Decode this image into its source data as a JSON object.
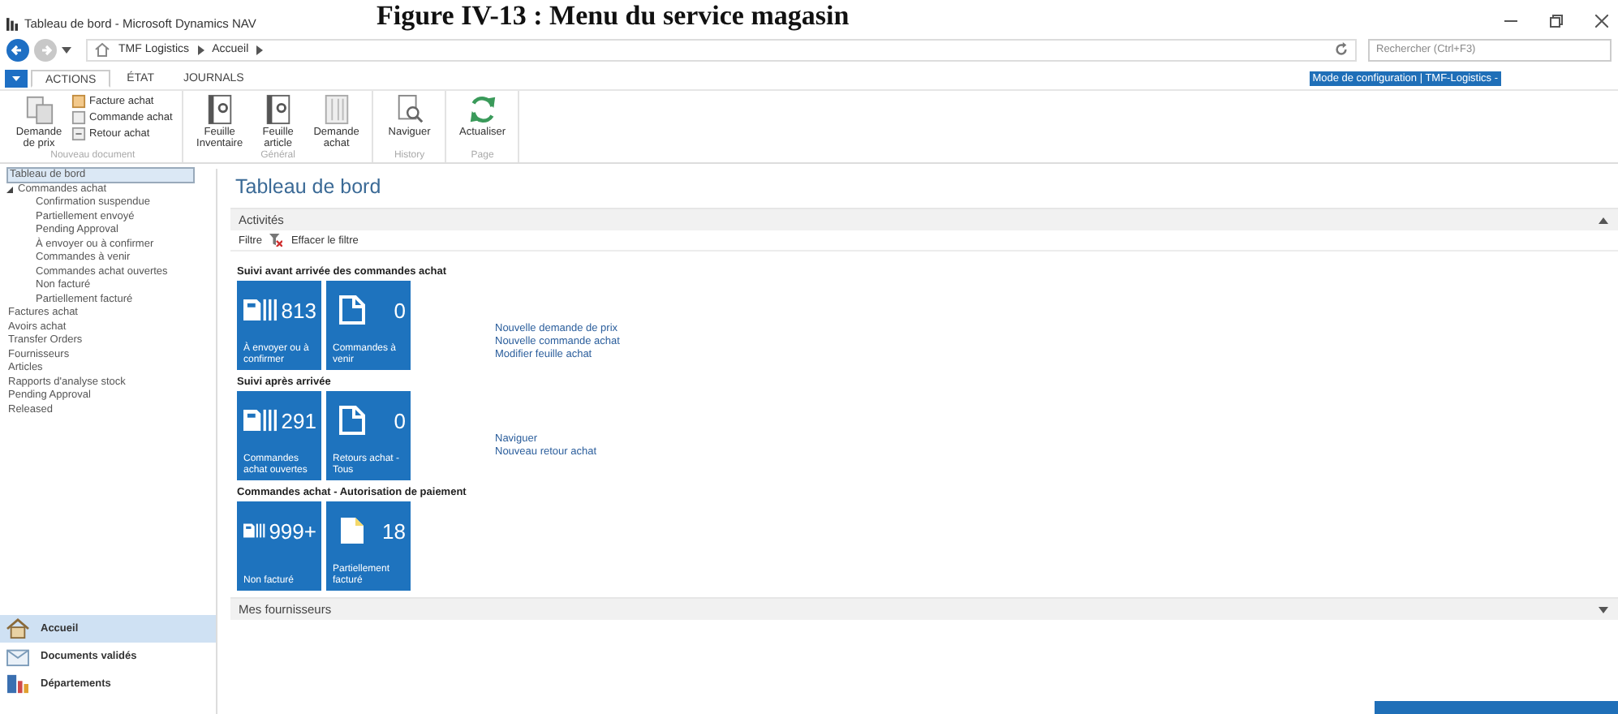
{
  "caption": "Figure IV-13 : Menu du service magasin",
  "window": {
    "title": "Tableau de bord - Microsoft Dynamics NAV"
  },
  "navigation": {
    "breadcrumb": [
      "TMF Logistics",
      "Accueil"
    ],
    "search": {
      "placeholder": "Rechercher (Ctrl+F3)"
    }
  },
  "ribbon": {
    "tabs": [
      {
        "label": "ACTIONS",
        "selected": true
      },
      {
        "label": "ÉTAT",
        "selected": false
      },
      {
        "label": "JOURNALS",
        "selected": false
      }
    ],
    "configuration": "Mode de configuration | TMF-Logistics -",
    "groups": [
      {
        "name": "Nouveau document",
        "items": [
          {
            "kind": "large",
            "label": "Demande de prix"
          },
          {
            "kind": "small",
            "label": "Facture achat"
          },
          {
            "kind": "small",
            "label": "Commande achat"
          },
          {
            "kind": "small",
            "label": "Retour achat"
          }
        ]
      },
      {
        "name": "Général",
        "items": [
          {
            "kind": "large",
            "label": "Feuille Inventaire"
          },
          {
            "kind": "large",
            "label": "Feuille article"
          },
          {
            "kind": "large",
            "label": "Demande achat"
          }
        ]
      },
      {
        "name": "History",
        "items": [
          {
            "kind": "large",
            "label": "Naviguer"
          }
        ]
      },
      {
        "name": "Page",
        "items": [
          {
            "kind": "large",
            "label": "Actualiser"
          }
        ]
      }
    ]
  },
  "sidebar": {
    "items": [
      {
        "label": "Tableau de bord",
        "selected": true
      },
      {
        "label": "Commandes achat",
        "selected": false,
        "expanded": true,
        "children": [
          {
            "label": "Confirmation suspendue",
            "selected": false
          },
          {
            "label": "Partiellement envoyé",
            "selected": false
          },
          {
            "label": "Pending Approval",
            "selected": false
          },
          {
            "label": "À envoyer ou à confirmer",
            "selected": false
          },
          {
            "label": "Commandes à venir",
            "selected": false
          },
          {
            "label": "Commandes achat ouvertes",
            "selected": false
          },
          {
            "label": "Non facturé",
            "selected": false
          },
          {
            "label": "Partiellement facturé",
            "selected": false
          }
        ]
      },
      {
        "label": "Factures achat",
        "selected": false
      },
      {
        "label": "Avoirs achat",
        "selected": false
      },
      {
        "label": "Transfer Orders",
        "selected": false
      },
      {
        "label": "Fournisseurs",
        "selected": false
      },
      {
        "label": "Articles",
        "selected": false
      },
      {
        "label": "Rapports d'analyse stock",
        "selected": false
      },
      {
        "label": "Pending Approval",
        "selected": false
      },
      {
        "label": "Released",
        "selected": false
      }
    ],
    "departments": [
      {
        "label": "Accueil",
        "selected": true
      },
      {
        "label": "Documents validés",
        "selected": false
      },
      {
        "label": "Départements",
        "selected": false
      }
    ]
  },
  "content": {
    "title": "Tableau de bord",
    "sections": [
      {
        "title": "Activités",
        "expanded": true,
        "filter": {
          "label": "Filtre",
          "clear": "Effacer le filtre"
        },
        "groups": [
          {
            "title": "Suivi avant arrivée des commandes achat",
            "tiles": [
              {
                "kind": "stack",
                "count": "813",
                "label": "À envoyer ou à confirmer"
              },
              {
                "kind": "page",
                "count": "0",
                "label": "Commandes à venir"
              }
            ],
            "links": [
              "Nouvelle demande de prix",
              "Nouvelle commande achat",
              "Modifier feuille achat"
            ]
          },
          {
            "title": "Suivi après arrivée",
            "tiles": [
              {
                "kind": "stack",
                "count": "291",
                "label": "Commandes achat ouvertes"
              },
              {
                "kind": "page",
                "count": "0",
                "label": "Retours achat - Tous"
              }
            ],
            "links": [
              "Naviguer",
              "Nouveau retour achat"
            ]
          },
          {
            "title": "Commandes achat - Autorisation de paiement",
            "tiles": [
              {
                "kind": "stack",
                "count": "999+",
                "label": "Non facturé"
              },
              {
                "kind": "filled",
                "count": "18",
                "label": "Partiellement facturé"
              }
            ]
          }
        ]
      },
      {
        "title": "Mes fournisseurs",
        "expanded": false
      }
    ]
  }
}
